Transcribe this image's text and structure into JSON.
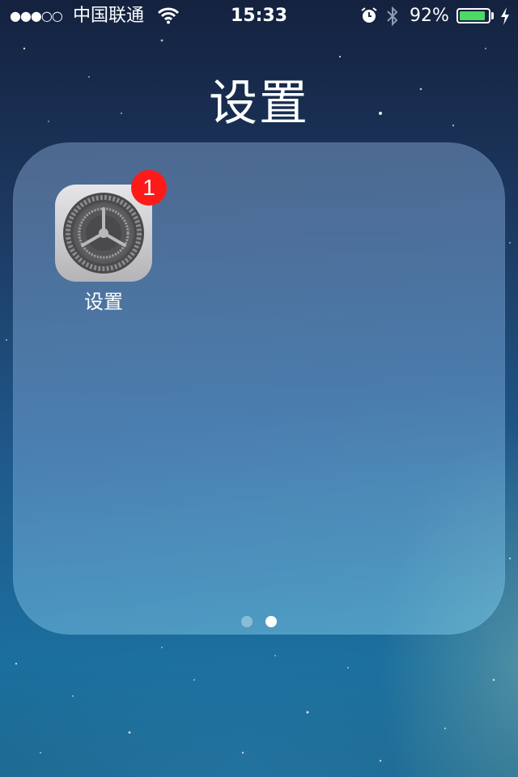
{
  "status_bar": {
    "signal": "●●●○○",
    "carrier": "中国联通",
    "time": "15:33",
    "battery_percent": "92%",
    "battery_level": 0.92,
    "icons": [
      "wifi-icon",
      "alarm-icon",
      "bluetooth-icon",
      "battery-icon",
      "charging-icon"
    ]
  },
  "folder": {
    "title": "设置",
    "apps": [
      {
        "label": "设置",
        "icon": "settings-gear-icon",
        "badge": "1"
      }
    ],
    "page_dots": {
      "count": 2,
      "active_index": 1
    }
  },
  "colors": {
    "badge": "#ff1a1a",
    "battery_fill": "#4cd964"
  }
}
